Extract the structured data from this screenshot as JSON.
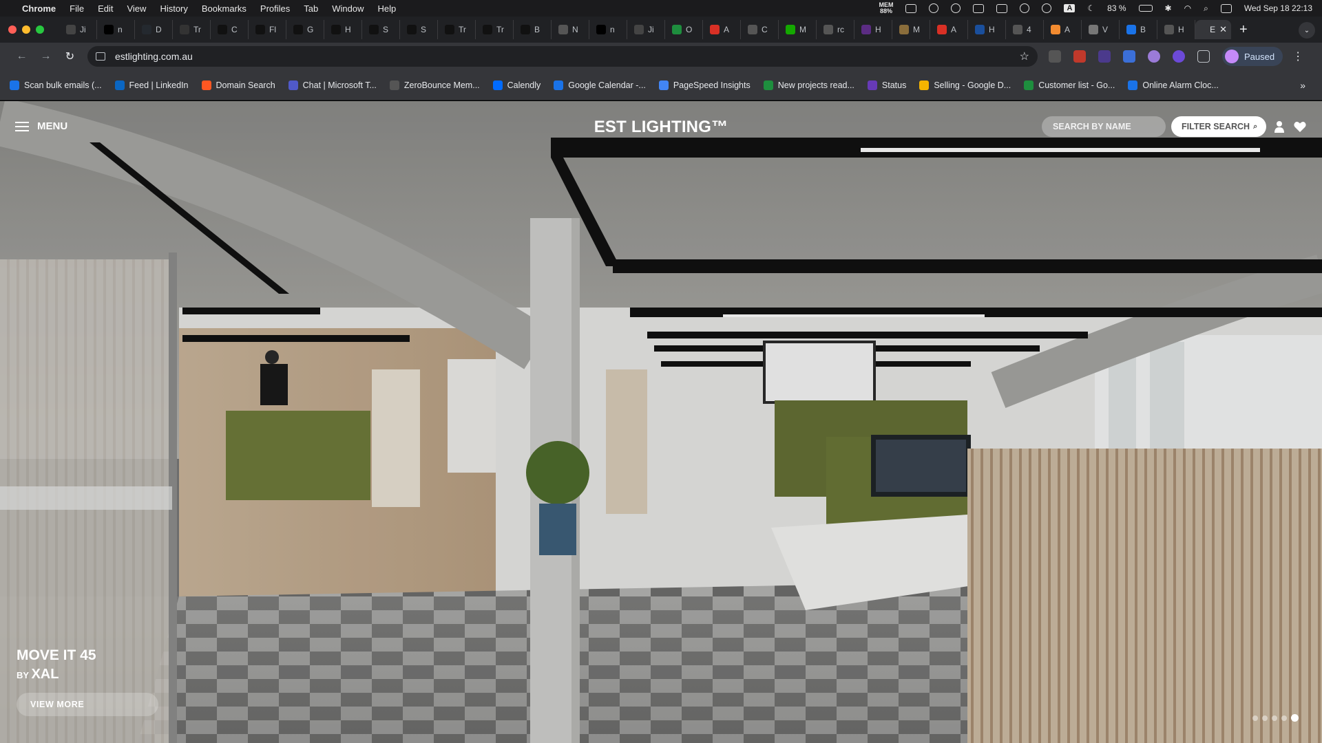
{
  "menubar": {
    "app_name": "Chrome",
    "menus": [
      "File",
      "Edit",
      "View",
      "History",
      "Bookmarks",
      "Profiles",
      "Tab",
      "Window",
      "Help"
    ],
    "mem_label": "MEM",
    "mem_value": "88%",
    "keyboard_input": "A",
    "battery": "83 %",
    "datetime": "Wed Sep 18  22:13"
  },
  "tabs": [
    {
      "label": "Ji",
      "icon": "ji-icon",
      "color": "#444"
    },
    {
      "label": "n",
      "icon": "triangle-icon",
      "color": "#000"
    },
    {
      "label": "D",
      "icon": "github-icon",
      "color": "#24292f"
    },
    {
      "label": "Tr",
      "icon": "tr-icon",
      "color": "#333"
    },
    {
      "label": "C",
      "icon": "prompt-icon",
      "color": "#111"
    },
    {
      "label": "Fl",
      "icon": "prompt-icon",
      "color": "#111"
    },
    {
      "label": "G",
      "icon": "prompt-icon",
      "color": "#111"
    },
    {
      "label": "H",
      "icon": "prompt-icon",
      "color": "#111"
    },
    {
      "label": "S",
      "icon": "prompt-icon",
      "color": "#111"
    },
    {
      "label": "S",
      "icon": "prompt-icon",
      "color": "#111"
    },
    {
      "label": "Tr",
      "icon": "a-icon",
      "color": "#111"
    },
    {
      "label": "Tr",
      "icon": "prompt-icon",
      "color": "#111"
    },
    {
      "label": "B",
      "icon": "prompt-icon",
      "color": "#111"
    },
    {
      "label": "N",
      "icon": "chatgpt-icon",
      "color": "#555"
    },
    {
      "label": "n",
      "icon": "triangle-icon",
      "color": "#000"
    },
    {
      "label": "Ji",
      "icon": "ji-icon",
      "color": "#444"
    },
    {
      "label": "O",
      "icon": "sheets-icon",
      "color": "#1e8e3e"
    },
    {
      "label": "A",
      "icon": "red-icon",
      "color": "#d93025"
    },
    {
      "label": "C",
      "icon": "chatgpt-icon",
      "color": "#555"
    },
    {
      "label": "M",
      "icon": "up-icon",
      "color": "#14a800"
    },
    {
      "label": "rc",
      "icon": "chatgpt-icon",
      "color": "#555"
    },
    {
      "label": "H",
      "icon": "purple-icon",
      "color": "#5b2c83"
    },
    {
      "label": "M",
      "icon": "pin-icon",
      "color": "#8a6d3b"
    },
    {
      "label": "A",
      "icon": "red-icon",
      "color": "#d93025"
    },
    {
      "label": "H",
      "icon": "blue-icon",
      "color": "#1a4f9c"
    },
    {
      "label": "4",
      "icon": "chatgpt-icon",
      "color": "#555"
    },
    {
      "label": "A",
      "icon": "orange-icon",
      "color": "#f28b30"
    },
    {
      "label": "V",
      "icon": "white-icon",
      "color": "#777"
    },
    {
      "label": "B",
      "icon": "calendar-icon",
      "color": "#1a73e8"
    },
    {
      "label": "H",
      "icon": "cf-icon",
      "color": "#555"
    },
    {
      "label": "E",
      "icon": "est-icon",
      "color": "#35363a",
      "active": true
    }
  ],
  "toolbar": {
    "url": "estlighting.com.au",
    "profile_status": "Paused"
  },
  "bookmarks": [
    {
      "label": "Scan bulk emails (...",
      "icon": "mail-icon",
      "color": "#1a73e8"
    },
    {
      "label": "Feed | LinkedIn",
      "icon": "linkedin-icon",
      "color": "#0a66c2"
    },
    {
      "label": "Domain Search",
      "icon": "hunter-icon",
      "color": "#ff5722"
    },
    {
      "label": "Chat | Microsoft T...",
      "icon": "teams-icon",
      "color": "#5059c9"
    },
    {
      "label": "ZeroBounce Mem...",
      "icon": "zb-icon",
      "color": "#555"
    },
    {
      "label": "Calendly",
      "icon": "calendly-icon",
      "color": "#006bff"
    },
    {
      "label": "Google Calendar -...",
      "icon": "calendar-icon",
      "color": "#1a73e8"
    },
    {
      "label": "PageSpeed Insights",
      "icon": "pagespeed-icon",
      "color": "#4285f4"
    },
    {
      "label": "New projects read...",
      "icon": "sheets-icon",
      "color": "#1e8e3e"
    },
    {
      "label": "Status",
      "icon": "list-icon",
      "color": "#673ab7"
    },
    {
      "label": "Selling - Google D...",
      "icon": "drive-icon",
      "color": "#f4b400"
    },
    {
      "label": "Customer list - Go...",
      "icon": "sheets-icon",
      "color": "#1e8e3e"
    },
    {
      "label": "Online Alarm Cloc...",
      "icon": "clock-icon",
      "color": "#1a73e8"
    }
  ],
  "site": {
    "menu_label": "MENU",
    "logo": "EST LIGHTING™",
    "search_placeholder": "SEARCH BY NAME",
    "filter_label": "FILTER SEARCH",
    "hero_product": "MOVE IT 45",
    "hero_by": "BY",
    "hero_brand": "XAL",
    "cta_label": "VIEW MORE",
    "slide_count": 5,
    "active_slide": 5
  }
}
